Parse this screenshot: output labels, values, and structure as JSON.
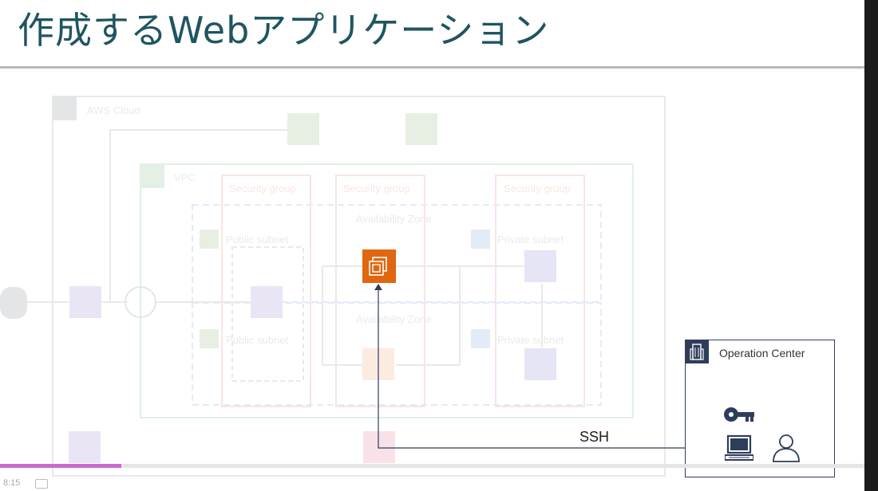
{
  "slide": {
    "title": "作成するWebアプリケーション"
  },
  "background_diagram": {
    "aws_cloud": "AWS Cloud",
    "vpc": "VPC",
    "security_groups": [
      "Security group",
      "Security group",
      "Security group"
    ],
    "availability_zones": [
      "Availability Zone",
      "Availability Zone"
    ],
    "public_subnets": [
      "Public subnet",
      "Public subnet"
    ],
    "private_subnets": [
      "Private subnet",
      "Private subnet"
    ]
  },
  "operation_center": {
    "label": "Operation Center"
  },
  "connection": {
    "label": "SSH"
  },
  "player": {
    "time": "8:15",
    "progress": 0.14
  },
  "colors": {
    "title": "#1f5561",
    "ec2": "#e0660f",
    "ops_border": "#2e3d5a",
    "progress": "#c86bd0"
  },
  "icons": [
    "aws-cloud-icon",
    "s3-bucket-icon",
    "vpc-icon",
    "users-icon",
    "internet-icon",
    "gateway-icon",
    "load-balancer-icon",
    "ec2-instance-icon",
    "rds-icon",
    "lock-icon",
    "building-icon",
    "key-icon",
    "laptop-icon",
    "user-icon"
  ]
}
